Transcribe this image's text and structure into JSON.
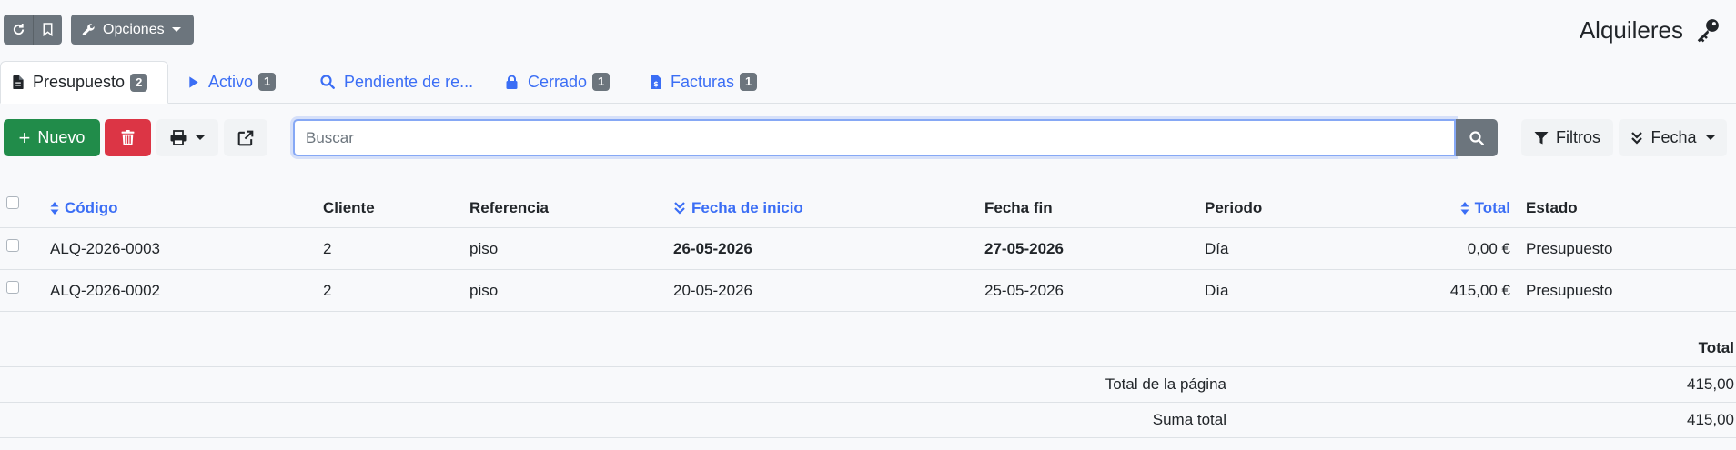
{
  "header": {
    "options_label": "Opciones",
    "title": "Alquileres"
  },
  "tabs": [
    {
      "label": "Presupuesto",
      "badge": "2",
      "icon": "file-icon",
      "active": true
    },
    {
      "label": "Activo",
      "badge": "1",
      "icon": "play-icon"
    },
    {
      "label": "Pendiente de re...",
      "badge": "",
      "icon": "search-icon"
    },
    {
      "label": "Cerrado",
      "badge": "1",
      "icon": "lock-icon"
    },
    {
      "label": "Facturas",
      "badge": "1",
      "icon": "invoice-icon"
    }
  ],
  "toolbar": {
    "new_label": "Nuevo",
    "search_placeholder": "Buscar",
    "search_value": "",
    "filters_label": "Filtros",
    "date_label": "Fecha"
  },
  "table": {
    "columns": [
      "Código",
      "Cliente",
      "Referencia",
      "Fecha de inicio",
      "Fecha fin",
      "Periodo",
      "Total",
      "Estado"
    ],
    "rows": [
      {
        "code": "ALQ-2026-0003",
        "client": "2",
        "ref": "piso",
        "start": "26-05-2026",
        "end": "27-05-2026",
        "period": "Día",
        "total": "0,00 €",
        "state": "Presupuesto"
      },
      {
        "code": "ALQ-2026-0002",
        "client": "2",
        "ref": "piso",
        "start": "20-05-2026",
        "end": "25-05-2026",
        "period": "Día",
        "total": "415,00 €",
        "state": "Presupuesto"
      }
    ]
  },
  "totals": {
    "header": "Total",
    "rows": [
      {
        "label": "Total de la página",
        "value": "415,00"
      },
      {
        "label": "Suma total",
        "value": "415,00"
      }
    ]
  },
  "colors": {
    "primary": "#3b6ef5",
    "success": "#218c4a",
    "danger": "#dc3545",
    "secondary": "#6c757d"
  }
}
